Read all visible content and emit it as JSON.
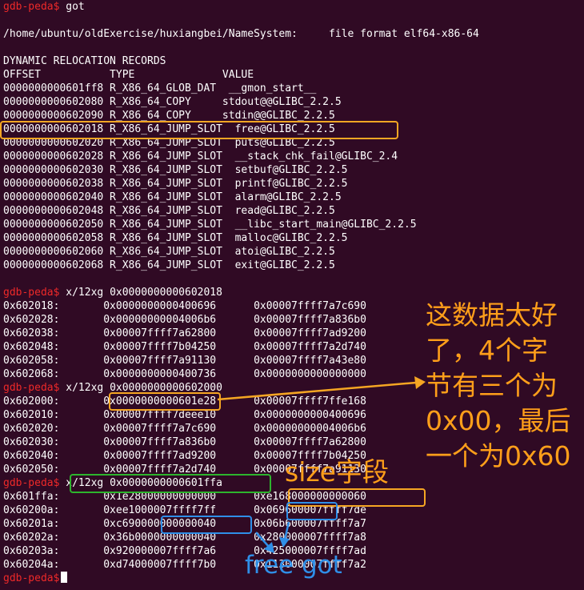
{
  "terminal": {
    "prompt": "gdb-peda$",
    "cmd_got": " got",
    "header_path": "/home/ubuntu/oldExercise/huxiangbei/NameSystem:     file format elf64-x86-64",
    "reloc_title": "DYNAMIC RELOCATION RECORDS",
    "reloc_columns": "OFFSET           TYPE              VALUE",
    "reloc_rows": [
      "0000000000601ff8 R_X86_64_GLOB_DAT  __gmon_start__",
      "0000000000602080 R_X86_64_COPY     stdout@@GLIBC_2.2.5",
      "0000000000602090 R_X86_64_COPY     stdin@@GLIBC_2.2.5",
      "0000000000602018 R_X86_64_JUMP_SLOT  free@GLIBC_2.2.5",
      "0000000000602020 R_X86_64_JUMP_SLOT  puts@GLIBC_2.2.5",
      "0000000000602028 R_X86_64_JUMP_SLOT  __stack_chk_fail@GLIBC_2.4",
      "0000000000602030 R_X86_64_JUMP_SLOT  setbuf@GLIBC_2.2.5",
      "0000000000602038 R_X86_64_JUMP_SLOT  printf@GLIBC_2.2.5",
      "0000000000602040 R_X86_64_JUMP_SLOT  alarm@GLIBC_2.2.5",
      "0000000000602048 R_X86_64_JUMP_SLOT  read@GLIBC_2.2.5",
      "0000000000602050 R_X86_64_JUMP_SLOT  __libc_start_main@GLIBC_2.2.5",
      "0000000000602058 R_X86_64_JUMP_SLOT  malloc@GLIBC_2.2.5",
      "0000000000602060 R_X86_64_JUMP_SLOT  atoi@GLIBC_2.2.5",
      "0000000000602068 R_X86_64_JUMP_SLOT  exit@GLIBC_2.2.5"
    ],
    "cmd1": " x/12xg 0x0000000000602018",
    "dump1": [
      "0x602018:       0x0000000000400696      0x00007ffff7a7c690",
      "0x602028:       0x00000000004006b6      0x00007ffff7a836b0",
      "0x602038:       0x00007ffff7a62800      0x00007ffff7ad9200",
      "0x602048:       0x00007ffff7b04250      0x00007ffff7a2d740",
      "0x602058:       0x00007ffff7a91130      0x00007ffff7a43e80",
      "0x602068:       0x0000000000400736      0x0000000000000000"
    ],
    "cmd2": " x/12xg 0x0000000000602000",
    "dump2": [
      "0x602000:       0x0000000000601e28      0x00007ffff7ffe168",
      "0x602010:       0x00007ffff7deee10      0x0000000000400696",
      "0x602020:       0x00007ffff7a7c690      0x00000000004006b6",
      "0x602030:       0x00007ffff7a836b0      0x00007ffff7a62800",
      "0x602040:       0x00007ffff7ad9200      0x00007ffff7b04250",
      "0x602050:       0x00007ffff7a2d740      0x00007ffff7a91130"
    ],
    "cmd3": " x/12xg 0x0000000000601ffa",
    "dump3": [
      "0x601ffa:       0x1e28000000000000      0xe168000000000060",
      "0x60200a:       0xee1000007ffff7ff      0x069600007ffff7de",
      "0x60201a:       0xc690000000000040      0x06b600007ffff7a7",
      "0x60202a:       0x36b0000000000040      0x280000007ffff7a8",
      "0x60203a:       0x920000007ffff7a6      0x425000007ffff7ad",
      "0x60204a:       0xd74000007ffff7b0      0x113000007ffff7a2"
    ]
  },
  "annotations": {
    "note_main": "这数据太好\n了，4个字\n节有三个为\n0x00，最后\n一个为0x60",
    "note_size": "size字段",
    "note_free_got": "free got"
  },
  "colors": {
    "background": "#300a24",
    "prompt": "#ef2929",
    "orange": "#f5a623",
    "green": "#2db42d",
    "blue": "#2f8fe8"
  }
}
